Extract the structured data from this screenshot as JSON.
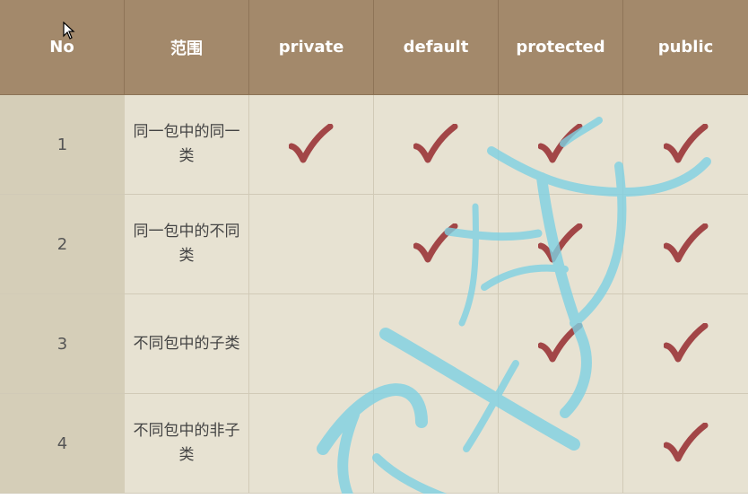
{
  "table": {
    "headers": [
      "No",
      "范围",
      "private",
      "default",
      "protected",
      "public"
    ],
    "rows": [
      {
        "no": "1",
        "scope": "同一包中的同一类",
        "private": true,
        "default": true,
        "protected": true,
        "public": true
      },
      {
        "no": "2",
        "scope": "同一包中的不同类",
        "private": false,
        "default": true,
        "protected": true,
        "public": true
      },
      {
        "no": "3",
        "scope": "不同包中的子类",
        "private": false,
        "default": false,
        "protected": true,
        "public": true
      },
      {
        "no": "4",
        "scope": "不同包中的非子类",
        "private": false,
        "default": false,
        "protected": false,
        "public": true
      }
    ]
  },
  "colors": {
    "header_bg": "#a3896b",
    "body_bg": "#e7e2d2",
    "no_col_bg": "#d5ceb8",
    "check": "#a24647",
    "watermark": "#7fd1e3"
  },
  "icons": {
    "check": "check-icon",
    "cursor": "mouse-cursor-icon"
  }
}
